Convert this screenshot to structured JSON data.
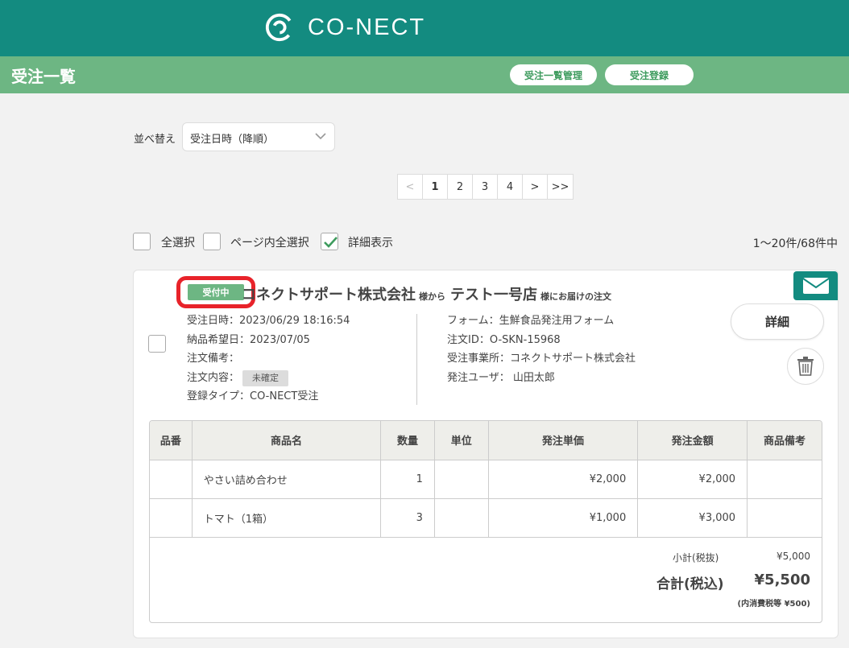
{
  "brand": {
    "name": "CO-NECT"
  },
  "header": {
    "title": "受注一覧",
    "btn_mgmt": "受注一覧管理",
    "btn_register": "受注登録"
  },
  "sort": {
    "label": "並べ替え",
    "value": "受注日時（降順）"
  },
  "pagination": {
    "prev": "<",
    "pages": [
      "1",
      "2",
      "3",
      "4"
    ],
    "next": ">",
    "last": ">>",
    "current": "1"
  },
  "selection": {
    "select_all": "全選択",
    "select_page": "ページ内全選択",
    "show_detail": "詳細表示",
    "count": "1〜20件/68件中"
  },
  "order": {
    "status": "受付中",
    "from_company": "コネクトサポート株式会社",
    "from_suffix": "様から",
    "to_store": "テスト一号店",
    "to_suffix": "様にお届けの注文",
    "order_datetime": "受注日時：2023/06/29 18:16:54",
    "delivery_date": "納品希望日：2023/07/05",
    "note": "注文備考：",
    "content_label": "注文内容：",
    "content_status": "未確定",
    "reg_type": "登録タイプ：CO-NECT受注",
    "form": "フォーム：生鮮食品発注用フォーム",
    "order_id": "注文ID：O-SKN-15968",
    "office": "受注事業所：コネクトサポート株式会社",
    "user": "発注ユーザ： 山田太郎",
    "detail_btn": "詳細"
  },
  "table": {
    "headers": [
      "品番",
      "商品名",
      "数量",
      "単位",
      "発注単価",
      "発注金額",
      "商品備考"
    ],
    "rows": [
      {
        "code": "",
        "name": "やさい詰め合わせ",
        "qty": "1",
        "unit": "",
        "price": "¥2,000",
        "amount": "¥2,000",
        "note": ""
      },
      {
        "code": "",
        "name": "トマト（1箱）",
        "qty": "3",
        "unit": "",
        "price": "¥1,000",
        "amount": "¥3,000",
        "note": ""
      }
    ]
  },
  "summary": {
    "subtotal_label": "小計(税抜)",
    "subtotal": "¥5,000",
    "total_label": "合計(税込)",
    "total": "¥5,500",
    "tax_note": "(内消費税等 ¥500)"
  },
  "colors": {
    "brand": "#138b80",
    "subbar": "#6db683",
    "highlight": "#e8232a"
  }
}
